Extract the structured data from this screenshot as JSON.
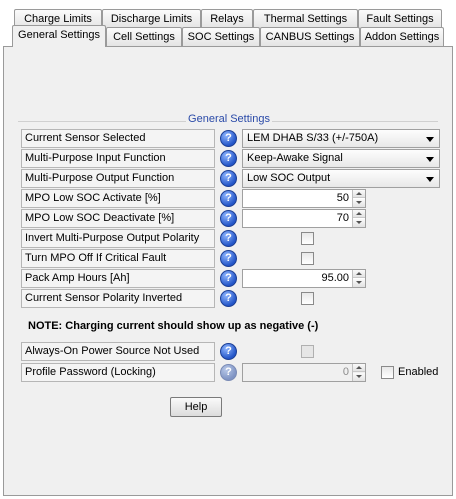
{
  "tabs_row1": [
    {
      "label": "Charge Limits"
    },
    {
      "label": "Discharge Limits"
    },
    {
      "label": "Relays"
    },
    {
      "label": "Thermal Settings"
    },
    {
      "label": "Fault Settings"
    }
  ],
  "tabs_row2": [
    {
      "label": "General Settings",
      "active": true
    },
    {
      "label": "Cell Settings"
    },
    {
      "label": "SOC Settings"
    },
    {
      "label": "CANBUS Settings"
    },
    {
      "label": "Addon Settings"
    }
  ],
  "group_title": "General Settings",
  "help_glyph": "?",
  "rows": {
    "current_sensor": {
      "label": "Current Sensor Selected",
      "value": "LEM DHAB S/33 (+/-750A)"
    },
    "mpi_function": {
      "label": "Multi-Purpose Input Function",
      "value": "Keep-Awake Signal"
    },
    "mpo_function": {
      "label": "Multi-Purpose Output Function",
      "value": "Low SOC Output"
    },
    "mpo_low_soc_activate": {
      "label": "MPO Low SOC Activate [%]",
      "value": "50"
    },
    "mpo_low_soc_deactivate": {
      "label": "MPO Low SOC Deactivate [%]",
      "value": "70"
    },
    "invert_mpo_polarity": {
      "label": "Invert Multi-Purpose Output Polarity",
      "checked": false
    },
    "turn_mpo_off": {
      "label": "Turn MPO Off If Critical Fault",
      "checked": false
    },
    "pack_amp_hours": {
      "label": "Pack Amp Hours [Ah]",
      "value": "95.00"
    },
    "current_sensor_inverted": {
      "label": "Current Sensor Polarity Inverted",
      "checked": false
    },
    "always_on_power": {
      "label": "Always-On Power Source Not Used",
      "checked": false
    },
    "profile_password": {
      "label": "Profile Password (Locking)",
      "value": "0",
      "enabled_label": "Enabled",
      "enabled_checked": false
    }
  },
  "note": "NOTE: Charging current should show up as negative (-)",
  "help_button": "Help"
}
